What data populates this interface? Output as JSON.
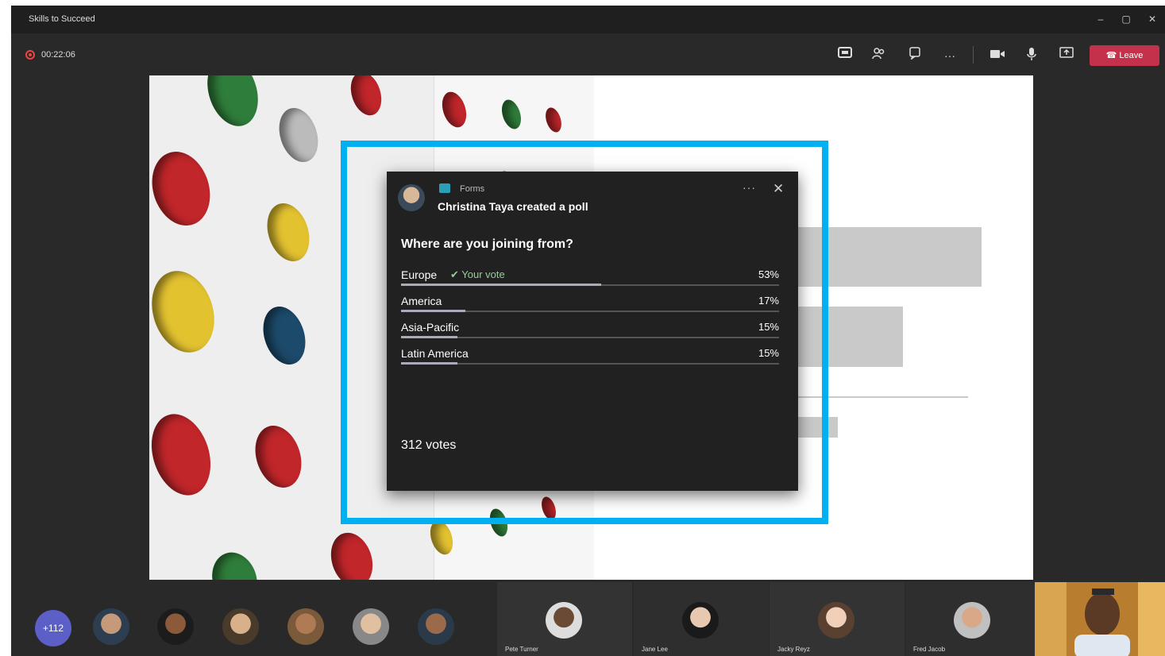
{
  "window": {
    "title": "Skills to Succeed",
    "minimize_glyph": "–",
    "maximize_glyph": "▢",
    "close_glyph": "✕"
  },
  "toolbar": {
    "timer": "00:22:06",
    "leave_label": "Leave",
    "more_glyph": "···",
    "icons": [
      "chat-icon",
      "people-icon",
      "raise-hand-icon",
      "more-options-icon",
      "camera-icon",
      "microphone-icon",
      "share-screen-icon",
      "hang-up-icon"
    ]
  },
  "poll": {
    "app_label": "Forms",
    "creator_text": "Christina Taya created a poll",
    "menu_glyph": "···",
    "close_glyph": "✕",
    "question": "Where are you joining from?",
    "options": [
      {
        "label": "Europe",
        "percent_text": "53%",
        "percent": 53,
        "vote_mark": "✔",
        "vote_text": "Your vote"
      },
      {
        "label": "America",
        "percent_text": "17%",
        "percent": 17
      },
      {
        "label": "Asia-Pacific",
        "percent_text": "15%",
        "percent": 15
      },
      {
        "label": "Latin America",
        "percent_text": "15%",
        "percent": 15
      }
    ],
    "votes_text": "312 votes"
  },
  "colors": {
    "highlight": "#00b0f0",
    "leave": "#c4314b",
    "overflow_badge": "#5b5fc7"
  },
  "roster": {
    "overflow_count": "+112",
    "tiles": [
      {
        "name": "Pete Turner"
      },
      {
        "name": "Jane Lee"
      },
      {
        "name": "Jacky Reyz"
      },
      {
        "name": "Fred Jacob"
      }
    ]
  }
}
